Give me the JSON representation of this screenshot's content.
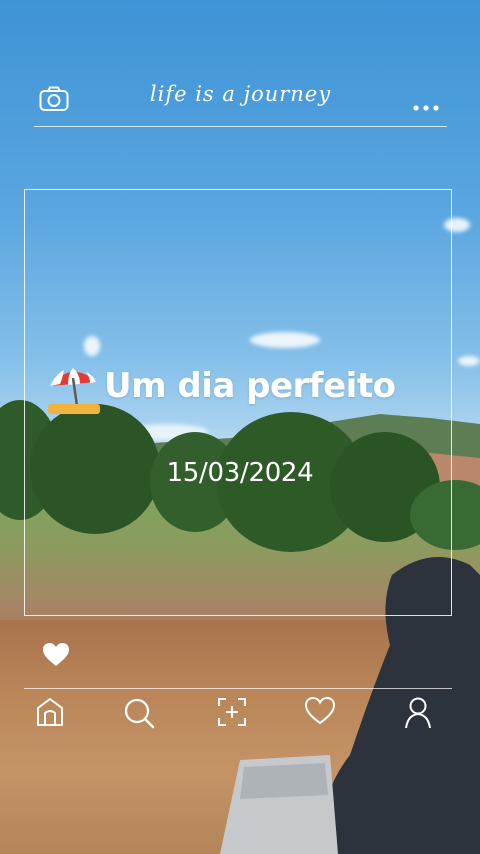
{
  "header": {
    "title": "life is a journey",
    "camera_icon": "camera-icon",
    "more_icon": "more-icon"
  },
  "post": {
    "emoji": "beach-umbrella-icon",
    "title": "Um dia perfeito",
    "date": "15/03/2024",
    "like_icon": "heart-filled-icon"
  },
  "nav": {
    "items": [
      {
        "icon": "home-icon"
      },
      {
        "icon": "search-icon"
      },
      {
        "icon": "add-icon"
      },
      {
        "icon": "heart-icon"
      },
      {
        "icon": "profile-icon"
      }
    ]
  },
  "colors": {
    "sky_top": "#3e93d6",
    "foreground": "#ffffff"
  }
}
